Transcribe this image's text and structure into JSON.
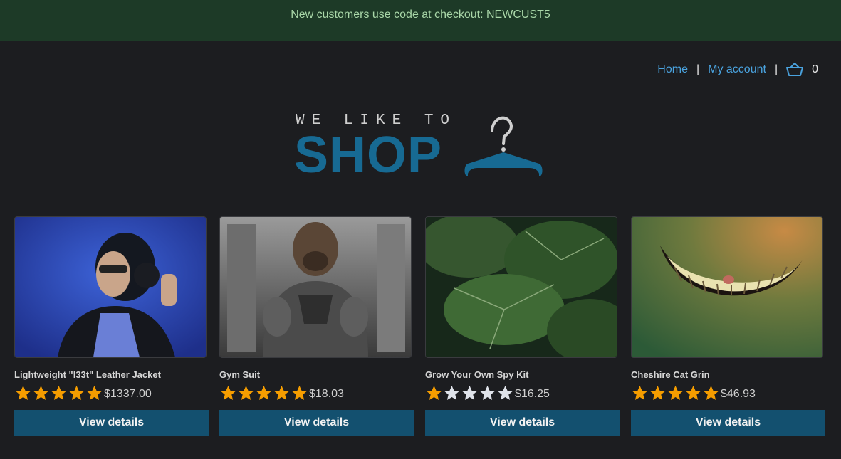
{
  "promo": {
    "text": "New customers use code at checkout: NEWCUST5"
  },
  "nav": {
    "home": "Home",
    "separator": "|",
    "account": "My account",
    "cart_count": "0"
  },
  "logo": {
    "tagline": "WE LIKE TO",
    "main": "SHOP"
  },
  "products": [
    {
      "name": "Lightweight \"l33t\" Leather Jacket",
      "rating": 5,
      "price": "$1337.00",
      "button": "View details",
      "image": "woman-headphones-jacket"
    },
    {
      "name": "Gym Suit",
      "rating": 5,
      "price": "$18.03",
      "button": "View details",
      "image": "dog-bodybuilder"
    },
    {
      "name": "Grow Your Own Spy Kit",
      "rating": 1,
      "price": "$16.25",
      "button": "View details",
      "image": "green-leaves"
    },
    {
      "name": "Cheshire Cat Grin",
      "rating": 5,
      "price": "$46.93",
      "button": "View details",
      "image": "cat-grin"
    }
  ],
  "colors": {
    "promo_bg": "#1d3a27",
    "accent": "#176a93",
    "button": "#13506f",
    "star_on": "#f59d00",
    "star_off": "#dfe3ea"
  }
}
